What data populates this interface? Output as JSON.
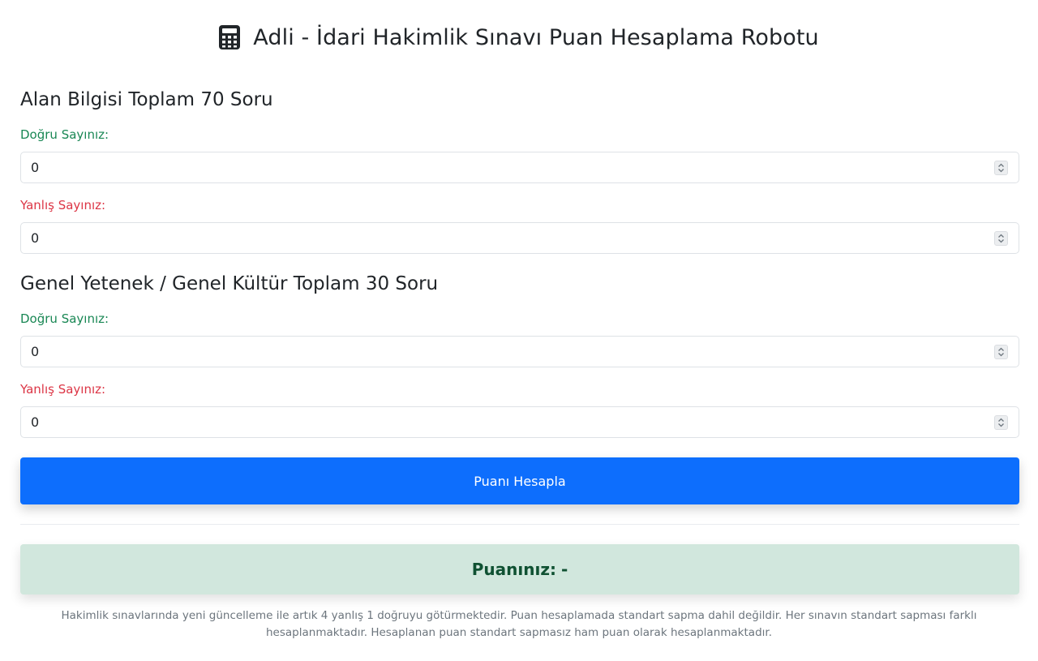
{
  "header": {
    "icon": "calculator-icon",
    "title": "Adli - İdari Hakimlik Sınavı Puan Hesaplama Robotu"
  },
  "sections": [
    {
      "title": "Alan Bilgisi Toplam 70 Soru",
      "correct_label": "Doğru Sayınız:",
      "correct_value": "0",
      "wrong_label": "Yanlış Sayınız:",
      "wrong_value": "0"
    },
    {
      "title": "Genel Yetenek / Genel Kültür Toplam 30 Soru",
      "correct_label": "Doğru Sayınız:",
      "correct_value": "0",
      "wrong_label": "Yanlış Sayınız:",
      "wrong_value": "0"
    }
  ],
  "calculate_button": "Puanı Hesapla",
  "result": {
    "label": "Puanınız:",
    "value": "-"
  },
  "footnote": "Hakimlik sınavlarında yeni güncelleme ile artık 4 yanlış 1 doğruyu götürmektedir. Puan hesaplamada standart sapma dahil değildir. Her sınavın standart sapması farklı hesaplanmaktadır. Hesaplanan puan standart sapmasız ham puan olarak hesaplanmaktadır.",
  "colors": {
    "primary": "#0d6efd",
    "correct": "#198754",
    "wrong": "#dc3545",
    "result_bg": "#d1e7dd",
    "result_text": "#0f5132"
  }
}
